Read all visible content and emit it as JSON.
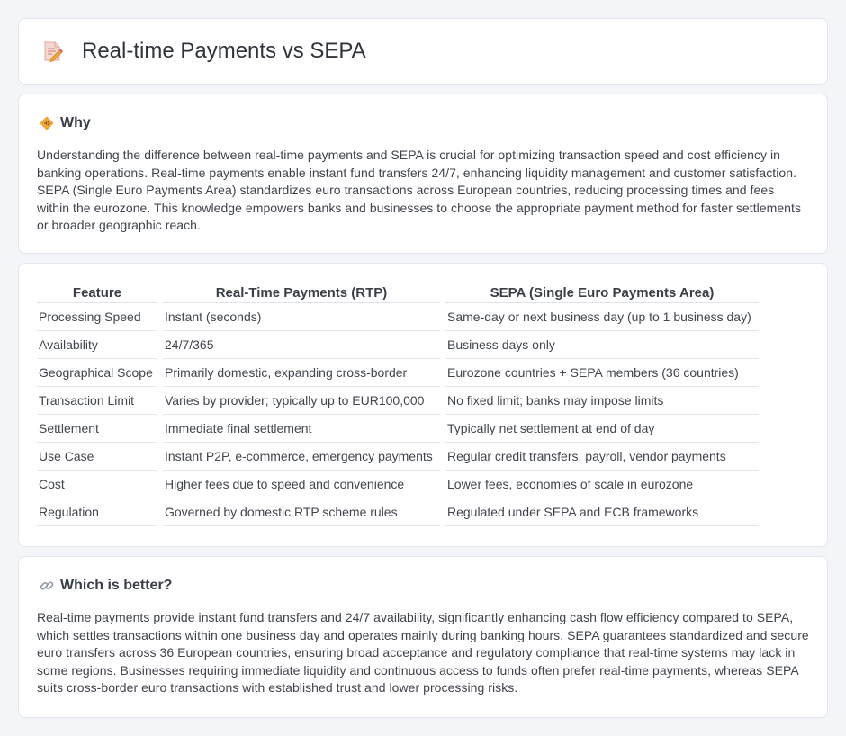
{
  "header": {
    "title": "Real-time Payments vs SEPA",
    "icon": "document-pencil-icon"
  },
  "why": {
    "icon": "diamond-arrows-icon",
    "title": "Why",
    "text": "Understanding the difference between real-time payments and SEPA is crucial for optimizing transaction speed and cost efficiency in banking operations. Real-time payments enable instant fund transfers 24/7, enhancing liquidity management and customer satisfaction. SEPA (Single Euro Payments Area) standardizes euro transactions across European countries, reducing processing times and fees within the eurozone. This knowledge empowers banks and businesses to choose the appropriate payment method for faster settlements or broader geographic reach."
  },
  "table": {
    "headers": [
      "Feature",
      "Real-Time Payments (RTP)",
      "SEPA (Single Euro Payments Area)"
    ],
    "rows": [
      [
        "Processing Speed",
        "Instant (seconds)",
        "Same-day or next business day (up to 1 business day)"
      ],
      [
        "Availability",
        "24/7/365",
        "Business days only"
      ],
      [
        "Geographical Scope",
        "Primarily domestic, expanding cross-border",
        "Eurozone countries + SEPA members (36 countries)"
      ],
      [
        "Transaction Limit",
        "Varies by provider; typically up to EUR100,000",
        "No fixed limit; banks may impose limits"
      ],
      [
        "Settlement",
        "Immediate final settlement",
        "Typically net settlement at end of day"
      ],
      [
        "Use Case",
        "Instant P2P, e-commerce, emergency payments",
        "Regular credit transfers, payroll, vendor payments"
      ],
      [
        "Cost",
        "Higher fees due to speed and convenience",
        "Lower fees, economies of scale in eurozone"
      ],
      [
        "Regulation",
        "Governed by domestic RTP scheme rules",
        "Regulated under SEPA and ECB frameworks"
      ]
    ]
  },
  "better": {
    "icon": "link-icon",
    "title": "Which is better?",
    "text": "Real-time payments provide instant fund transfers and 24/7 availability, significantly enhancing cash flow efficiency compared to SEPA, which settles transactions within one business day and operates mainly during banking hours. SEPA guarantees standardized and secure euro transfers across 36 European countries, ensuring broad acceptance and regulatory compliance that real-time systems may lack in some regions. Businesses requiring immediate liquidity and continuous access to funds often prefer real-time payments, whereas SEPA suits cross-border euro transactions with established trust and lower processing risks."
  },
  "colors": {
    "background": "#f3f5f9",
    "card": "#ffffff",
    "border": "#e3e7ee",
    "accent_orange": "#f0a43c",
    "accent_red": "#e0625a"
  }
}
